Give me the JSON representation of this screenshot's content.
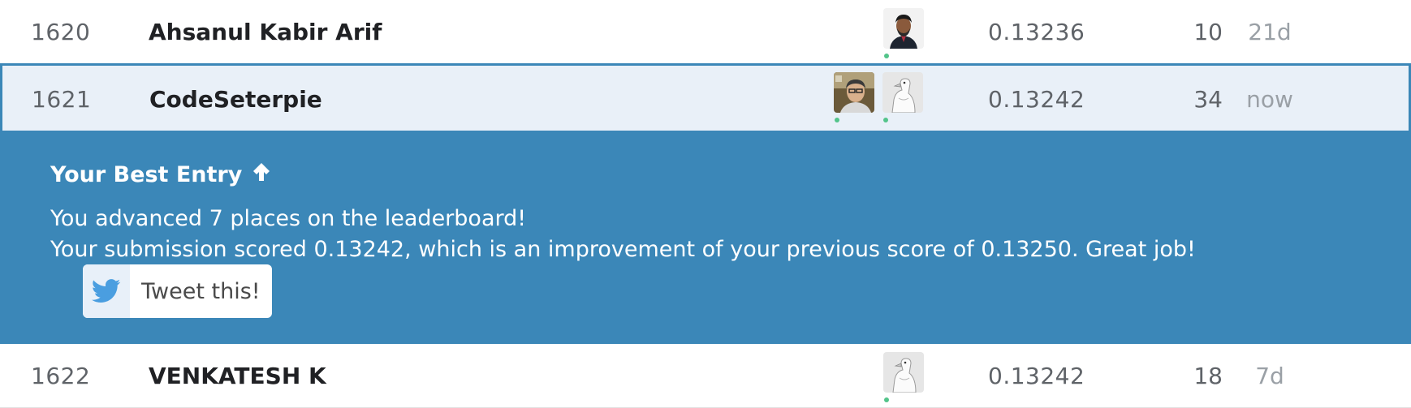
{
  "rows": [
    {
      "rank": "1620",
      "team": "Ahsanul Kabir Arif",
      "avatars": [
        "person-avatar"
      ],
      "score": "0.13236",
      "entries": "10",
      "last": "21d"
    },
    {
      "rank": "1621",
      "team": "CodeSeterpie",
      "avatars": [
        "person-avatar",
        "goose-avatar"
      ],
      "score": "0.13242",
      "entries": "34",
      "last": "now"
    },
    {
      "rank": "1622",
      "team": "VENKATESH K",
      "avatars": [
        "goose-avatar"
      ],
      "score": "0.13242",
      "entries": "18",
      "last": "7d"
    }
  ],
  "banner": {
    "title": "Your Best Entry",
    "title_icon": "arrow-up-icon",
    "line1": "You advanced 7 places on the leaderboard!",
    "line2": "Your submission scored 0.13242, which is an improvement of your previous score of 0.13250. Great job!",
    "tweet_label": "Tweet this!",
    "tweet_icon": "twitter-bird-icon"
  },
  "colors": {
    "banner_bg": "#3b87b8",
    "highlight_row_bg": "#e9f0f8",
    "online_dot": "#53c48a",
    "twitter_blue": "#4a9ee0"
  }
}
